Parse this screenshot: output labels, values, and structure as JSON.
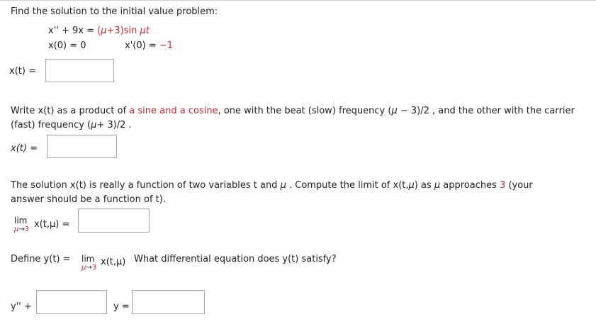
{
  "problem": {
    "title": "Find the solution to the initial value problem:",
    "equation": {
      "lhs": "x'' + 9x = ",
      "rhs_open": "(",
      "mu": "μ",
      "rhs_mid": "+3)sin ",
      "mu_t": "μt"
    },
    "ic1": "x(0) = 0",
    "ic2_label": "x'(0) = ",
    "ic2_value": "−1"
  },
  "part1": {
    "label": "x(t)  ="
  },
  "part2": {
    "text_a": "Write x(t) as a product of ",
    "text_red": "a sine and a cosine",
    "text_b": ", one with the beat (slow) frequency  (",
    "mu": "μ",
    "text_c": " − 3)/2 , and the other with the carrier",
    "line2_a": "(fast) frequency  (",
    "line2_b": "+ 3)/2 .",
    "label": "x(t)  ="
  },
  "part3": {
    "line1_a": "The solution x(t) is really a function of two variables  t  and  ",
    "line1_mu": "μ",
    "line1_b": " . Compute the limit of  x(t,",
    "line1_mu2": "μ",
    "line1_c": ")  as  ",
    "line1_mu3": "μ",
    "line1_d": "  approaches ",
    "line1_three": "3",
    "line1_e": " (your",
    "line2": "answer should be a function of t).",
    "lim_word": "lim",
    "lim_sub_mu": "μ",
    "lim_sub_arrow": "→",
    "lim_sub_val": "3",
    "lim_expr": "x(t,μ)  ="
  },
  "part4": {
    "define_a": "Define  y(t)  =",
    "lim_word": "lim",
    "lim_sub_mu": "μ",
    "lim_sub_arrow": "→",
    "lim_sub_val": "3",
    "lim_expr": "x(t,μ)",
    "question": "What differential equation does  y(t)  satisfy?",
    "y_label": "y'' +",
    "y_eq": "y  ="
  }
}
